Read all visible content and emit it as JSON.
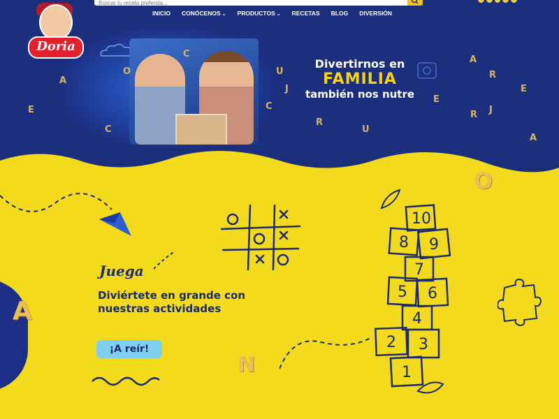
{
  "search": {
    "placeholder": "Buscar tu receta preferida..."
  },
  "nav": {
    "items": [
      {
        "label": "INICIO",
        "has_dropdown": false
      },
      {
        "label": "CONÓCENOS",
        "has_dropdown": true
      },
      {
        "label": "PRODUCTOS",
        "has_dropdown": true
      },
      {
        "label": "RECETAS",
        "has_dropdown": false
      },
      {
        "label": "BLOG",
        "has_dropdown": false
      },
      {
        "label": "DIVERSIÓN",
        "has_dropdown": false
      }
    ]
  },
  "logo": {
    "text": "Doria"
  },
  "hero": {
    "line1": "Divertirnos en",
    "line2": "FAMILIA",
    "line3": "también nos nutre",
    "floating_letters": [
      "C",
      "O",
      "A",
      "E",
      "C",
      "U",
      "J",
      "C",
      "R",
      "U",
      "A",
      "E",
      "J",
      "R",
      "E",
      "A",
      "R"
    ]
  },
  "activity": {
    "title": "Juega",
    "text_line1": "Diviértete en grande con",
    "text_line2": "nuestras actividades",
    "button_label": "¡A reír!"
  },
  "hopscotch": {
    "numbers": [
      "10",
      "8",
      "9",
      "7",
      "5",
      "6",
      "4",
      "2",
      "3",
      "1"
    ]
  },
  "bottom_letters": [
    "A",
    "N",
    "O"
  ],
  "colors": {
    "primary_blue": "#1b2f7e",
    "yellow": "#f4da1c",
    "button_blue": "#7fd0ee",
    "red": "#e3202d"
  }
}
